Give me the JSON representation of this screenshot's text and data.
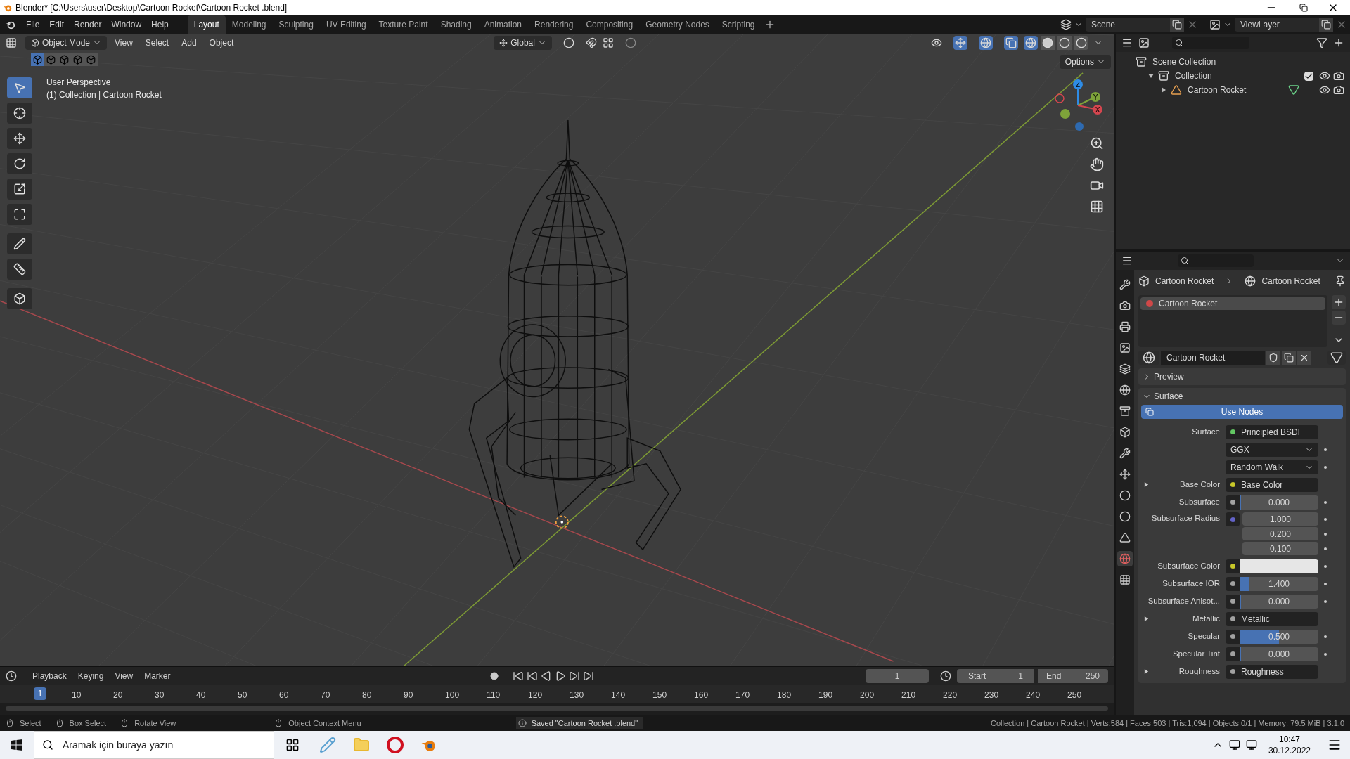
{
  "window": {
    "title": "Blender* [C:\\Users\\user\\Desktop\\Cartoon Rocket\\Cartoon Rocket .blend]"
  },
  "menu": [
    "File",
    "Edit",
    "Render",
    "Window",
    "Help"
  ],
  "workspaces": [
    {
      "label": "Layout",
      "selected": true
    },
    {
      "label": "Modeling",
      "selected": false
    },
    {
      "label": "Sculpting",
      "selected": false
    },
    {
      "label": "UV Editing",
      "selected": false
    },
    {
      "label": "Texture Paint",
      "selected": false
    },
    {
      "label": "Shading",
      "selected": false
    },
    {
      "label": "Animation",
      "selected": false
    },
    {
      "label": "Rendering",
      "selected": false
    },
    {
      "label": "Compositing",
      "selected": false
    },
    {
      "label": "Geometry Nodes",
      "selected": false
    },
    {
      "label": "Scripting",
      "selected": false
    }
  ],
  "scene": "Scene",
  "view_layer": "ViewLayer",
  "viewport": {
    "mode": "Object Mode",
    "menus": [
      "View",
      "Select",
      "Add",
      "Object"
    ],
    "orientation": "Global",
    "options": "Options",
    "info": [
      "User Perspective",
      "(1) Collection | Cartoon Rocket"
    ],
    "gizmo": [
      "Z",
      "Y",
      "X"
    ]
  },
  "outliner": {
    "items": [
      {
        "label": "Scene Collection",
        "kind": "scene",
        "children": [
          {
            "label": "Collection",
            "kind": "collection",
            "expanded": true,
            "children": [
              {
                "label": "Cartoon Rocket",
                "kind": "object",
                "expanded": false
              }
            ]
          }
        ]
      }
    ]
  },
  "properties": {
    "breadcrumb": [
      "Cartoon Rocket",
      "Cartoon Rocket"
    ],
    "slots": [
      {
        "label": "Cartoon Rocket",
        "selected": true
      }
    ],
    "material": "Cartoon Rocket",
    "panels": [
      {
        "label": "Preview",
        "expanded": false
      },
      {
        "label": "Surface",
        "expanded": true
      }
    ],
    "use_nodes": "Use Nodes",
    "rows": [
      {
        "kind": "link",
        "label": "Surface",
        "value": "Principled BSDF",
        "color": "#63c763",
        "expandable": false
      },
      {
        "kind": "dropdown",
        "value": "GGX"
      },
      {
        "kind": "dropdown",
        "value": "Random Walk"
      },
      {
        "kind": "link",
        "label": "Base Color",
        "value": "Base Color",
        "color": "#c7c729",
        "expandable": true
      },
      {
        "kind": "number",
        "label": "Subsurface",
        "value": "0.000",
        "color": "#a1a1a1",
        "level": 0
      },
      {
        "kind": "vector",
        "label": "Subsurface Radius",
        "values": [
          "1.000",
          "0.200",
          "0.100"
        ],
        "color": "#6363c7"
      },
      {
        "kind": "swatch",
        "label": "Subsurface Color",
        "color": "#c7c729"
      },
      {
        "kind": "number",
        "label": "Subsurface IOR",
        "value": "1.400",
        "color": "#a1a1a1",
        "level": 0.12
      },
      {
        "kind": "number",
        "label": "Subsurface Anisot...",
        "value": "0.000",
        "color": "#a1a1a1",
        "level": 0
      },
      {
        "kind": "link",
        "label": "Metallic",
        "value": "Metallic",
        "color": "#a1a1a1",
        "expandable": true
      },
      {
        "kind": "number",
        "label": "Specular",
        "value": "0.500",
        "color": "#a1a1a1",
        "level": 0.5
      },
      {
        "kind": "number",
        "label": "Specular Tint",
        "value": "0.000",
        "color": "#a1a1a1",
        "level": 0
      },
      {
        "kind": "link",
        "label": "Roughness",
        "value": "Roughness",
        "color": "#a1a1a1",
        "expandable": true
      }
    ]
  },
  "timeline": {
    "menus": [
      "Playback",
      "Keying",
      "View",
      "Marker"
    ],
    "frame": "1",
    "start_label": "Start",
    "start": "1",
    "end_label": "End",
    "end": "250",
    "playhead": "1",
    "ruler": [
      "10",
      "20",
      "30",
      "40",
      "50",
      "60",
      "70",
      "80",
      "90",
      "100",
      "110",
      "120",
      "130",
      "140",
      "150",
      "160",
      "170",
      "180",
      "190",
      "200",
      "210",
      "220",
      "230",
      "240",
      "250"
    ]
  },
  "status_bar": {
    "hints": [
      "Select",
      "Box Select",
      "Rotate View",
      "Object Context Menu"
    ],
    "message": "Saved \"Cartoon Rocket .blend\"",
    "stats": "Collection | Cartoon Rocket | Verts:584 | Faces:503 | Tris:1,094 | Objects:0/1 | Memory: 79.5 MiB | 3.1.0"
  },
  "taskbar": {
    "search_placeholder": "Aramak için buraya yazın",
    "time": "10:47",
    "date": "30.12.2022"
  }
}
